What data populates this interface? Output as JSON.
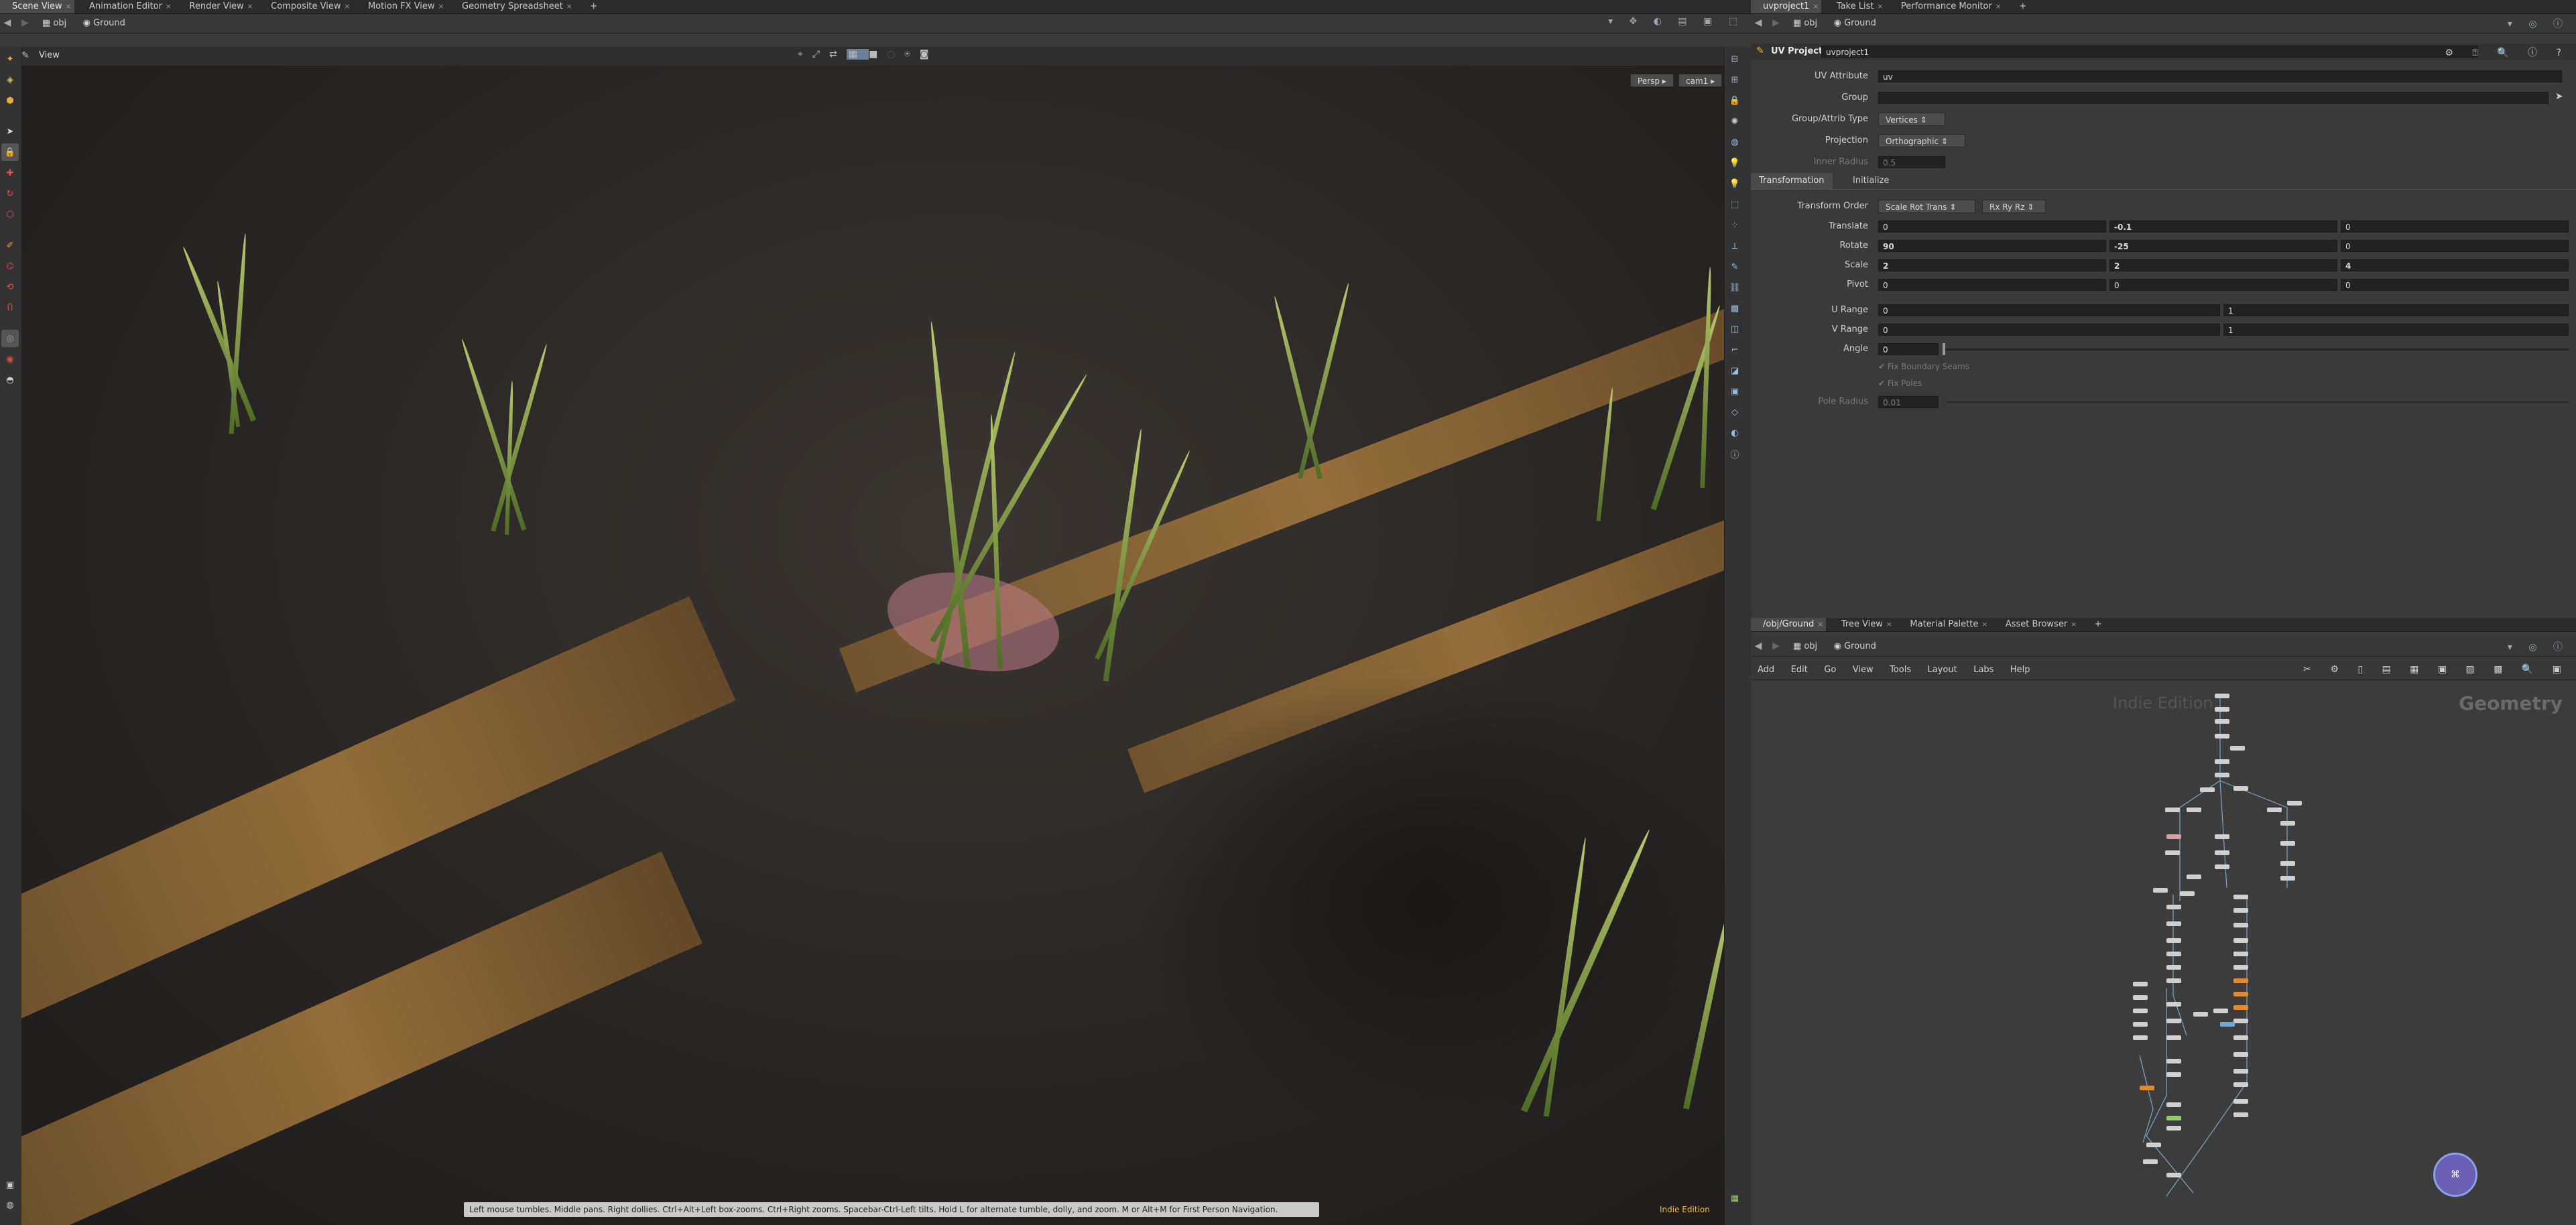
{
  "top_tabs": [
    "Scene View",
    "Animation Editor",
    "Render View",
    "Composite View",
    "Motion FX View",
    "Geometry Spreadsheet"
  ],
  "top_tab_add": "+",
  "left_path": {
    "root": "obj",
    "node": "Ground"
  },
  "viewport": {
    "title": "View",
    "persp": "Persp ▸",
    "cam": "cam1 ▸",
    "status": "Left mouse tumbles. Middle pans. Right dollies. Ctrl+Alt+Left box-zooms. Ctrl+Right zooms. Spacebar-Ctrl-Left tilts. Hold L for alternate tumble, dolly, and zoom.   M or Alt+M for First Person Navigation.",
    "edition": "Indie Edition"
  },
  "right_tabs": [
    "uvproject1",
    "Take List",
    "Performance Monitor"
  ],
  "right_path": {
    "root": "obj",
    "node": "Ground"
  },
  "params": {
    "node_type": "UV Project",
    "node_name": "uvproject1",
    "uv_attribute_label": "UV Attribute",
    "uv_attribute": "uv",
    "group_label": "Group",
    "group": "",
    "group_type_label": "Group/Attrib Type",
    "group_type": "Vertices",
    "projection_label": "Projection",
    "projection": "Orthographic",
    "inner_radius_label": "Inner Radius",
    "inner_radius": "0.5",
    "tab_transformation": "Transformation",
    "tab_initialize": "Initialize",
    "transform_order_label": "Transform Order",
    "transform_order": "Scale Rot Trans",
    "rot_order": "Rx Ry Rz",
    "translate_label": "Translate",
    "translate": [
      "0",
      "-0.1",
      "0"
    ],
    "rotate_label": "Rotate",
    "rotate": [
      "90",
      "-25",
      "0"
    ],
    "scale_label": "Scale",
    "scale": [
      "2",
      "2",
      "4"
    ],
    "pivot_label": "Pivot",
    "pivot": [
      "0",
      "0",
      "0"
    ],
    "urange_label": "U Range",
    "urange": [
      "0",
      "1"
    ],
    "vrange_label": "V Range",
    "vrange": [
      "0",
      "1"
    ],
    "angle_label": "Angle",
    "angle": "0",
    "fix_seams": "Fix Boundary Seams",
    "fix_poles": "Fix Poles",
    "pole_radius_label": "Pole Radius",
    "pole_radius": "0.01"
  },
  "net_tabs": [
    "/obj/Ground",
    "Tree View",
    "Material Palette",
    "Asset Browser"
  ],
  "net_path": {
    "root": "obj",
    "node": "Ground"
  },
  "net_menu": [
    "Add",
    "Edit",
    "Go",
    "View",
    "Tools",
    "Layout",
    "Labs",
    "Help"
  ],
  "net_watermark": "Indie Edition",
  "net_context": "Geometry",
  "colors": {
    "accent": "#e0b040",
    "panel": "#3a3a3a",
    "field": "#222222",
    "stripe": "#a77a3e",
    "grass": "#8fa84a"
  }
}
